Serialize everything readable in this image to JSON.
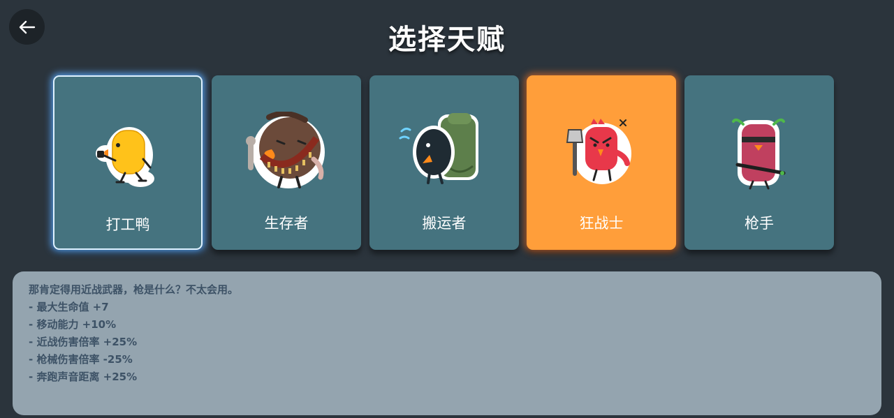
{
  "header": {
    "title": "选择天赋",
    "back_icon": "arrow-left-icon"
  },
  "colors": {
    "background": "#2b343c",
    "card": "#45737f",
    "card_active": "#ff9e3a",
    "panel": "#94a4af",
    "panel_text": "#3d5266"
  },
  "talents": [
    {
      "label": "打工鸭",
      "icon": "yellow-duck-icon",
      "state": "focused"
    },
    {
      "label": "生存者",
      "icon": "brown-survivor-duck-icon",
      "state": "normal"
    },
    {
      "label": "搬运者",
      "icon": "backpack-crow-icon",
      "state": "normal"
    },
    {
      "label": "狂战士",
      "icon": "red-axe-duck-icon",
      "state": "selected"
    },
    {
      "label": "枪手",
      "icon": "pink-gunner-duck-icon",
      "state": "normal"
    }
  ],
  "description": {
    "lines": [
      "那肯定得用近战武器，枪是什么？不太会用。",
      "- 最大生命值 +7",
      "- 移动能力 +10%",
      "- 近战伤害倍率 +25%",
      "- 枪械伤害倍率 -25%",
      "- 奔跑声音距离 +25%"
    ]
  }
}
